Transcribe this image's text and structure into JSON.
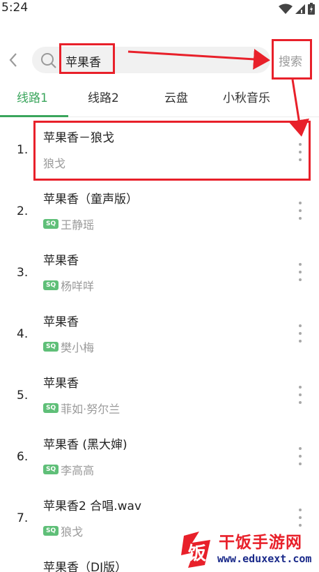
{
  "status_bar": {
    "time": "5:24",
    "icons": [
      "wifi-icon",
      "signal-icon",
      "battery-icon"
    ]
  },
  "search": {
    "value": "苹果香",
    "button_label": "搜索",
    "back_icon": "chevron-left-icon",
    "search_icon": "search-icon"
  },
  "tabs": [
    {
      "label": "线路1",
      "active": true
    },
    {
      "label": "线路2",
      "active": false
    },
    {
      "label": "云盘",
      "active": false
    },
    {
      "label": "小秋音乐",
      "active": false
    }
  ],
  "results": [
    {
      "index": "1.",
      "title": "苹果香－狼戈",
      "artist": "狼戈",
      "sq": false
    },
    {
      "index": "2.",
      "title": "苹果香（童声版）",
      "artist": "王静瑶",
      "sq": true
    },
    {
      "index": "3.",
      "title": "苹果香",
      "artist": "杨咩咩",
      "sq": true
    },
    {
      "index": "4.",
      "title": "苹果香",
      "artist": "樊小梅",
      "sq": true
    },
    {
      "index": "5.",
      "title": "苹果香",
      "artist": "菲如·努尔兰",
      "sq": true
    },
    {
      "index": "6.",
      "title": "苹果香 (黑大婶)",
      "artist": "李高高",
      "sq": true
    },
    {
      "index": "7.",
      "title": "苹果香2 合唱.wav",
      "artist": "狼戈",
      "sq": true
    },
    {
      "index": "8.",
      "title": "苹果香（DJ版）",
      "artist": "",
      "sq": false
    }
  ],
  "badge_text": "SQ",
  "colors": {
    "accent": "#3aa55c",
    "annotation": "#e8202a",
    "sq_badge": "#5fbf78"
  },
  "watermark": {
    "name": "干饭手游网",
    "url": "www.eduxext.com",
    "logo_char": "饭"
  }
}
